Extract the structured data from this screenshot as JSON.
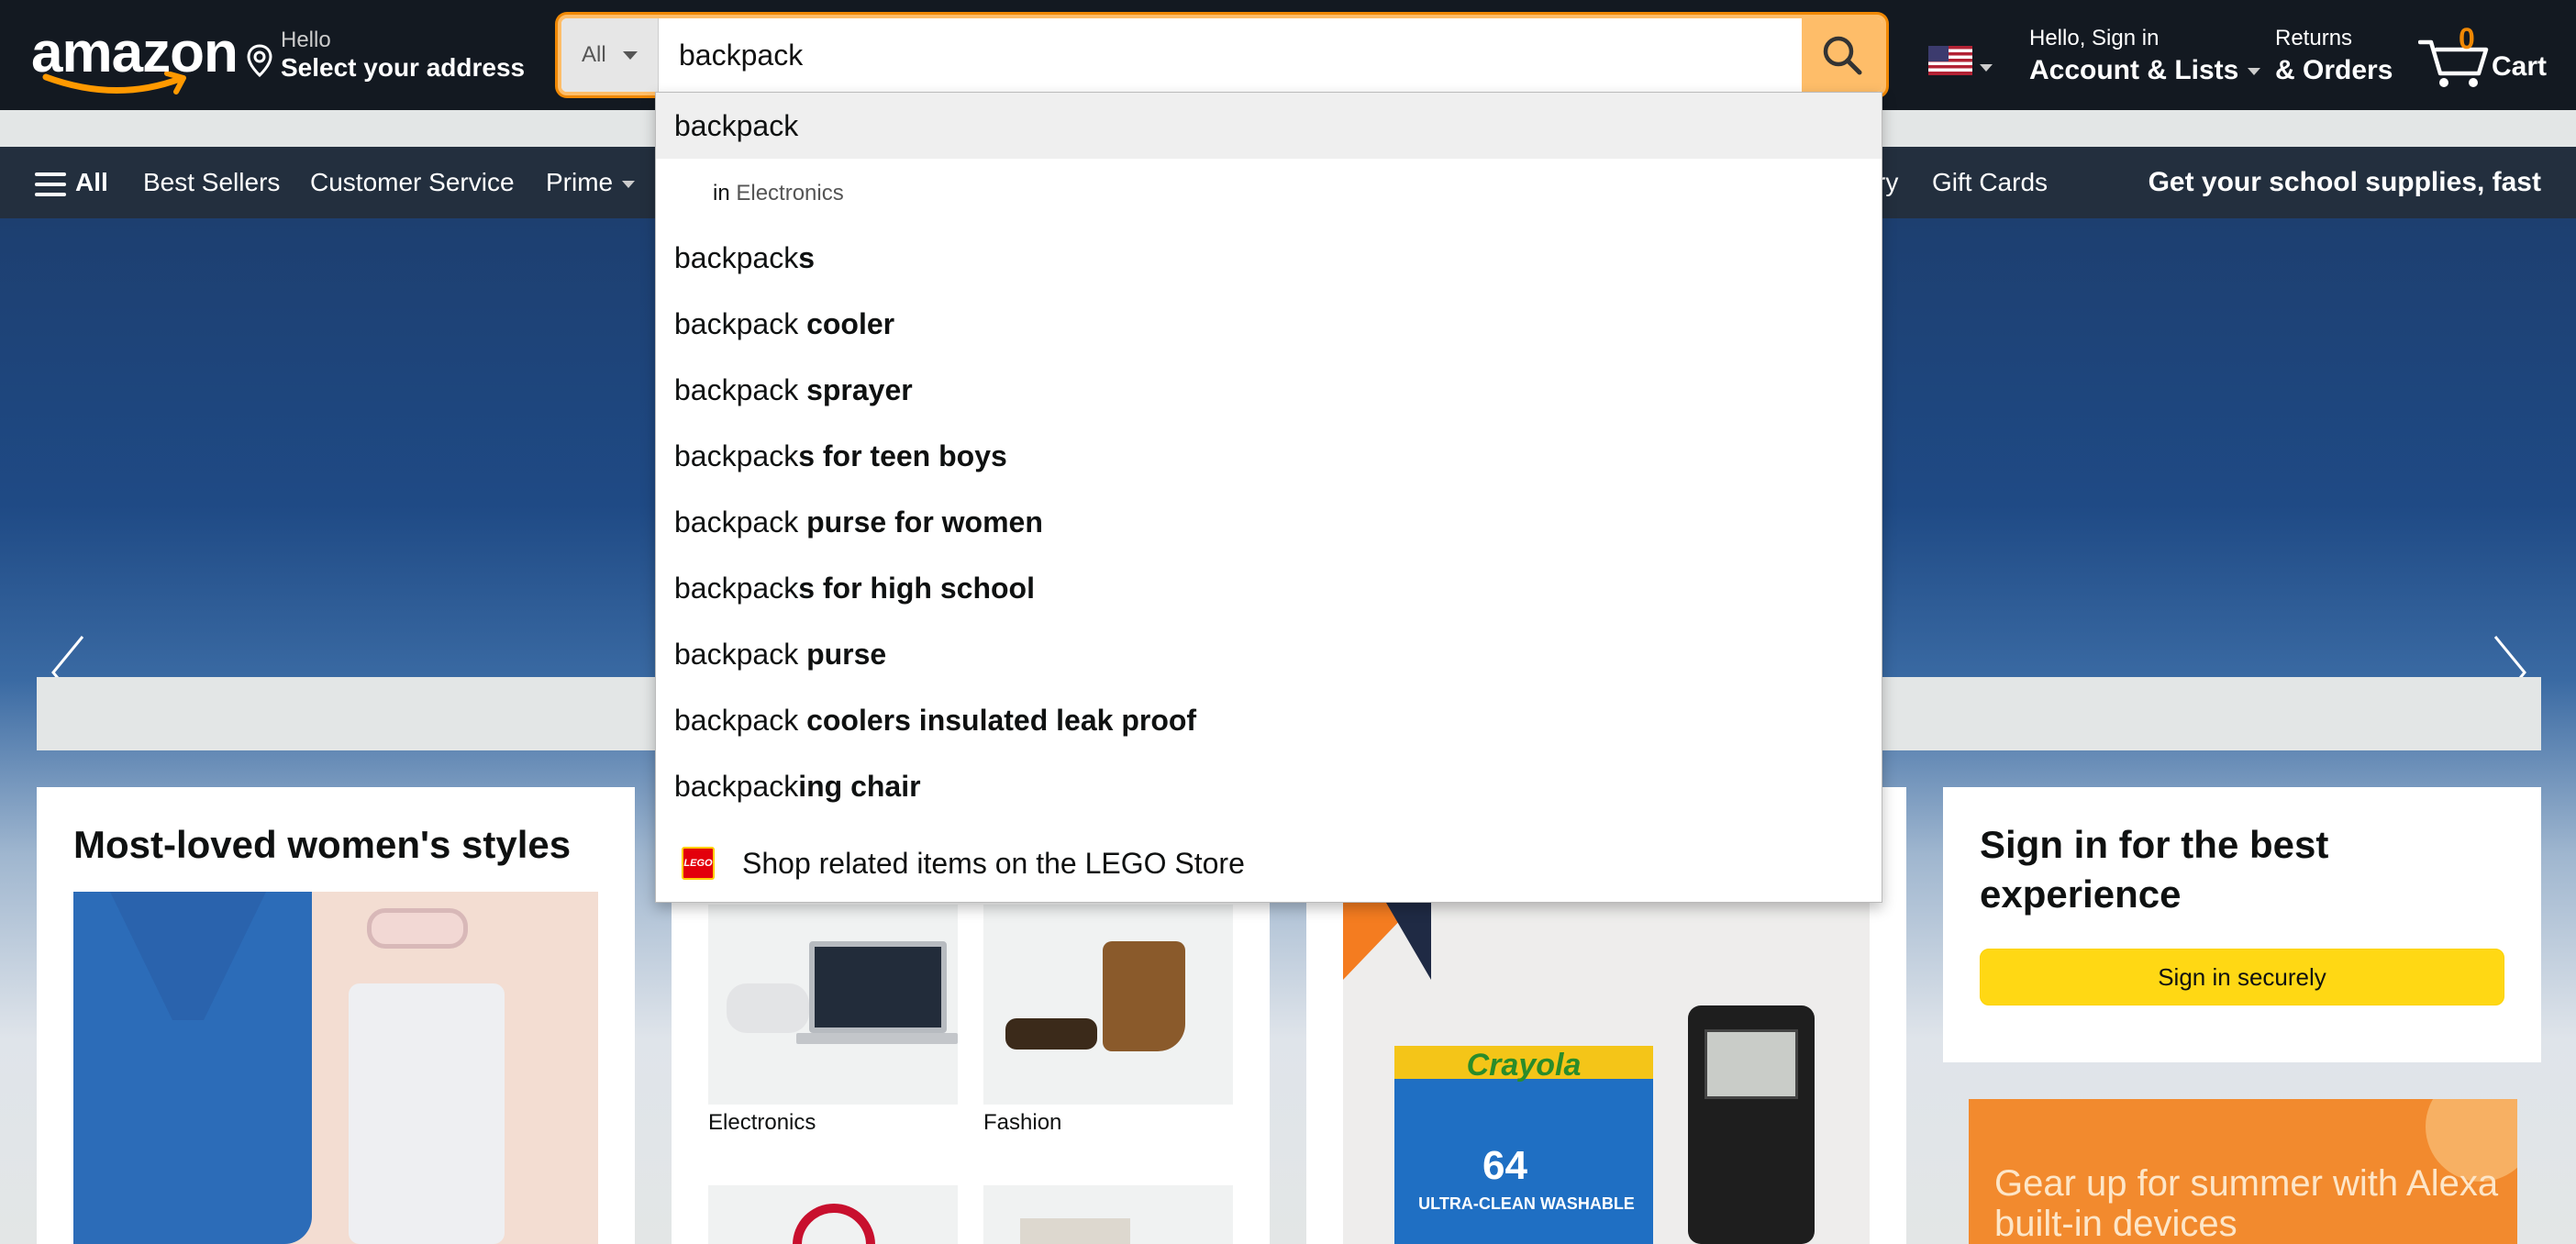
{
  "header": {
    "logo_text": "amazon",
    "deliver": {
      "line1": "Hello",
      "line2": "Select your address"
    },
    "search": {
      "category": "All",
      "query": "backpack"
    },
    "account": {
      "line1": "Hello, Sign in",
      "line2": "Account & Lists"
    },
    "returns": {
      "line1": "Returns",
      "line2": "& Orders"
    },
    "cart": {
      "count": "0",
      "label": "Cart"
    }
  },
  "nav": {
    "all": "All",
    "items": [
      "Best Sellers",
      "Customer Service",
      "Prime"
    ],
    "partial_item": "ry",
    "gift_cards": "Gift Cards",
    "promo": "Get your school supplies, fast"
  },
  "autocomplete": {
    "suggestions": [
      {
        "prefix": "backpack",
        "bold": ""
      },
      {
        "prefix": "backpack",
        "bold": "s"
      },
      {
        "prefix": "backpack ",
        "bold": "cooler"
      },
      {
        "prefix": "backpack ",
        "bold": "sprayer"
      },
      {
        "prefix": "backpack",
        "bold": "s for teen boys"
      },
      {
        "prefix": "backpack ",
        "bold": "purse for women"
      },
      {
        "prefix": "backpack",
        "bold": "s for high school"
      },
      {
        "prefix": "backpack ",
        "bold": "purse"
      },
      {
        "prefix": "backpack ",
        "bold": "coolers insulated leak proof"
      },
      {
        "prefix": "backpack",
        "bold": "ing chair"
      }
    ],
    "department": {
      "in": "in",
      "name": "Electronics"
    },
    "store_link": {
      "logo_text": "LEGO",
      "text": "Shop related items on the LEGO Store"
    }
  },
  "cards": {
    "womens": {
      "title": "Most-loved women's styles"
    },
    "categories": {
      "tiles": [
        "Electronics",
        "Fashion"
      ]
    },
    "signin": {
      "title": "Sign in for the best experience",
      "button": "Sign in securely"
    },
    "alexa": {
      "text": "Gear up for summer with Alexa built-in devices"
    },
    "school": {
      "crayola": "Crayola",
      "count": "64",
      "washable": "ULTRA-CLEAN WASHABLE"
    }
  },
  "colors": {
    "nav_bg": "#131921",
    "nav_main_bg": "#232f3e",
    "accent": "#febd69",
    "cart_count": "#f08804",
    "signin_button": "#ffd814"
  }
}
